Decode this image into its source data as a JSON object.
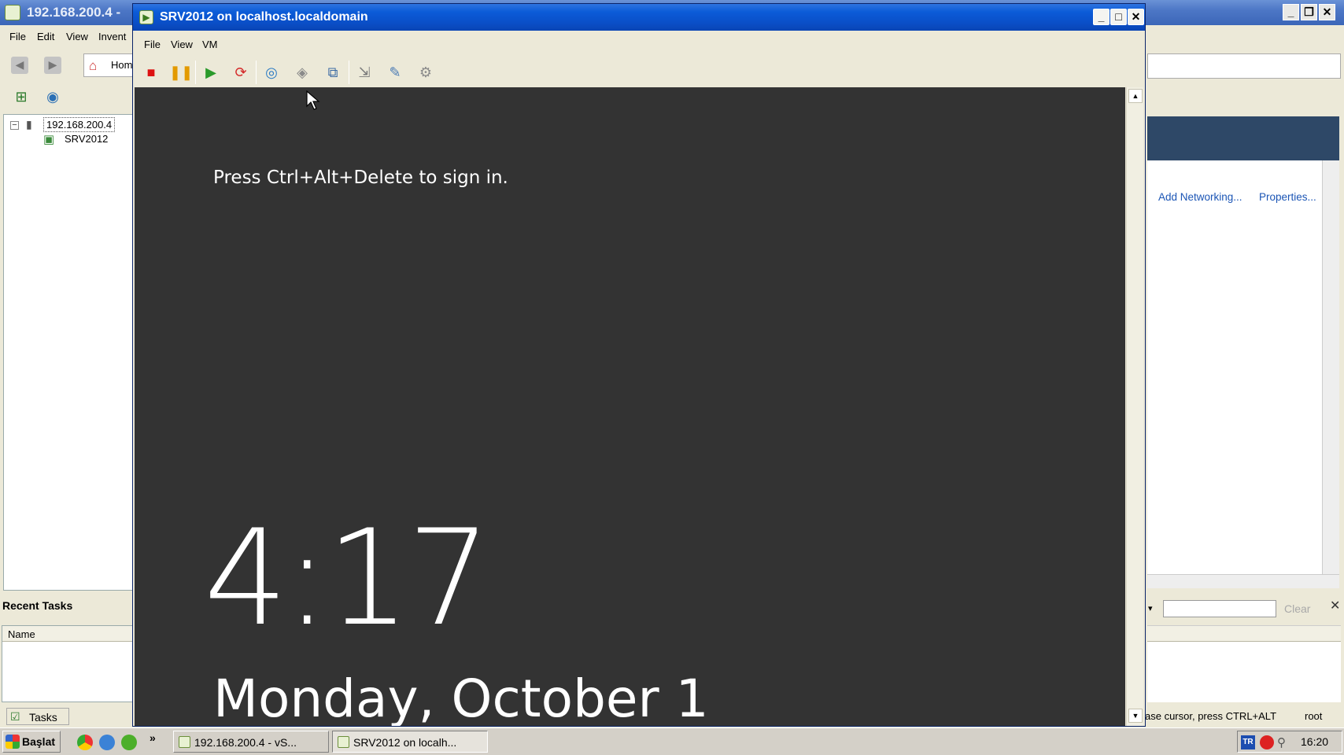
{
  "background_window": {
    "title": "192.168.200.4 - ",
    "menu": [
      "File",
      "Edit",
      "View",
      "Invent"
    ],
    "home_label": "Hom",
    "tree": {
      "host": "192.168.200.4",
      "vm": "SRV2012"
    },
    "recent_tasks_title": "Recent Tasks",
    "tasks_columns": [
      "Name"
    ],
    "tasks_tab": "Tasks",
    "right_links": [
      "Add Networking...",
      "Properties..."
    ],
    "filter_clear": "Clear",
    "status_text": "ase cursor, press CTRL+ALT",
    "status_user": "root"
  },
  "vm_window": {
    "title": "SRV2012 on localhost.localdomain",
    "menu": [
      "File",
      "View",
      "VM"
    ],
    "toolbar": [
      "power-off-icon",
      "suspend-icon",
      "power-on-icon",
      "reset-icon",
      "snapshot-icon",
      "revert-snapshot-icon",
      "snapshot-manager-icon",
      "console-fullscreen-icon",
      "vm-settings-icon",
      "vm-tools-icon"
    ],
    "colors": {
      "console_bg": "#333333",
      "title_blue": "#0b5bd8"
    }
  },
  "lock_screen": {
    "message": "Press Ctrl+Alt+Delete to sign in.",
    "time": "4:17",
    "date": "Monday, October 1"
  },
  "taskbar": {
    "start_label": "Başlat",
    "more": "»",
    "tasks": [
      "192.168.200.4 - vS...",
      "SRV2012 on localh..."
    ],
    "tray_lang": "TR",
    "clock": "16:20"
  }
}
